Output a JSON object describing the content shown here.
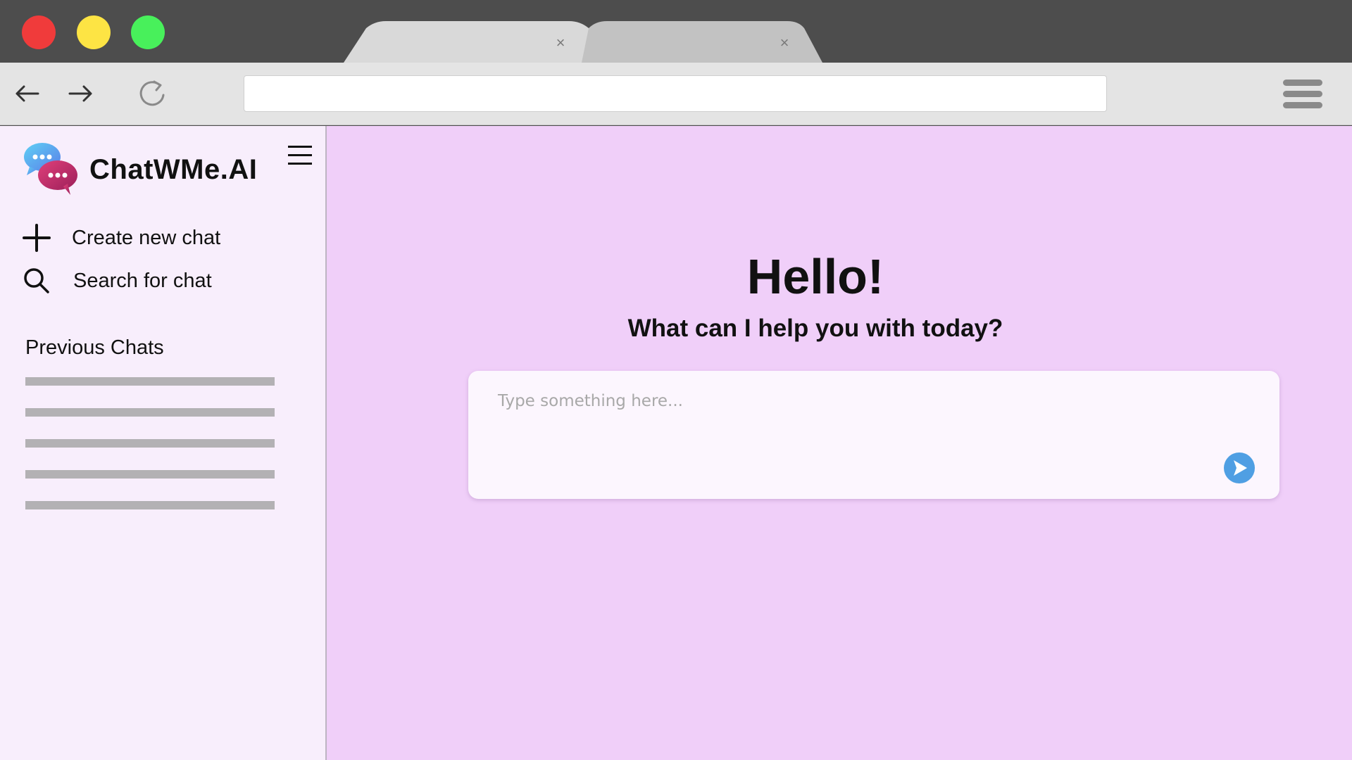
{
  "window": {
    "controls": [
      "close",
      "minimize",
      "maximize"
    ],
    "colors": {
      "close": "#f03b3b",
      "minimize": "#fde444",
      "maximize": "#48f05b"
    }
  },
  "tabs": [
    {
      "close_glyph": "×"
    },
    {
      "close_glyph": "×"
    }
  ],
  "toolbar": {
    "back_icon": "arrow-left-icon",
    "forward_icon": "arrow-right-icon",
    "reload_icon": "reload-icon",
    "address_value": "",
    "menu_icon": "menu-icon"
  },
  "sidebar": {
    "brand": "ChatWMe.AI",
    "actions": [
      {
        "icon": "plus-icon",
        "label": "Create new chat"
      },
      {
        "icon": "search-icon",
        "label": "Search for chat"
      }
    ],
    "previous_title": "Previous Chats",
    "previous_chats_count_placeholders": 5
  },
  "main": {
    "greeting": "Hello!",
    "subtitle": "What can I help you with today?",
    "prompt": {
      "placeholder": "Type something here...",
      "value": ""
    },
    "send_icon": "send-icon"
  },
  "colors": {
    "titlebar": "#4d4d4d",
    "toolbar": "#e4e4e4",
    "sidebar_bg": "#f8eefc",
    "main_bg": "#f0cff9",
    "placeholder_bar": "#b3b1b4",
    "send_button": "#4f9fe3"
  }
}
